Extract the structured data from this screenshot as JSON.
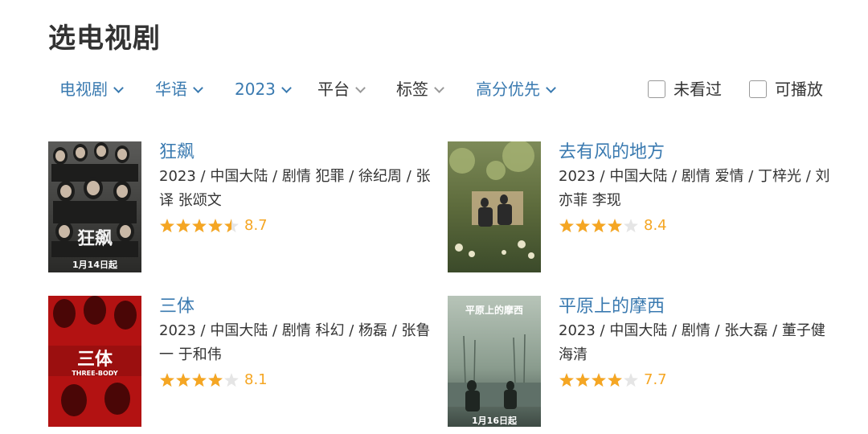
{
  "page_title": "选电视剧",
  "filters": [
    {
      "label": "电视剧",
      "active": true
    },
    {
      "label": "华语",
      "active": true
    },
    {
      "label": "2023",
      "active": true
    },
    {
      "label": "平台",
      "active": false
    },
    {
      "label": "标签",
      "active": false
    },
    {
      "label": "高分优先",
      "active": true
    }
  ],
  "checkboxes": [
    {
      "label": "未看过",
      "checked": false
    },
    {
      "label": "可播放",
      "checked": false
    }
  ],
  "colors": {
    "link_blue": "#3a7ab0",
    "star_gold": "#f5a623",
    "star_empty": "#e5e5e5"
  },
  "shows": [
    {
      "title": "狂飙",
      "meta": "2023 / 中国大陆 / 剧情 犯罪 / 徐纪周 / 张译 张颂文",
      "stars": 4.5,
      "score": "8.7",
      "poster_caption": "1月14日起",
      "poster_title": "狂飙",
      "poster_subtitle": ""
    },
    {
      "title": "去有风的地方",
      "meta": "2023 / 中国大陆 / 剧情 爱情 / 丁梓光 / 刘亦菲 李现",
      "stars": 4,
      "score": "8.4",
      "poster_caption": "",
      "poster_title": "",
      "poster_subtitle": ""
    },
    {
      "title": "三体",
      "meta": "2023 / 中国大陆 / 剧情 科幻 / 杨磊 / 张鲁一 于和伟",
      "stars": 4,
      "score": "8.1",
      "poster_caption": "",
      "poster_title": "三体",
      "poster_subtitle": "THREE-BODY"
    },
    {
      "title": "平原上的摩西",
      "meta": "2023 / 中国大陆 / 剧情 / 张大磊 / 董子健 海清",
      "stars": 4,
      "score": "7.7",
      "poster_caption": "1月16日起",
      "poster_title": "平原上的摩西",
      "poster_subtitle": ""
    }
  ]
}
